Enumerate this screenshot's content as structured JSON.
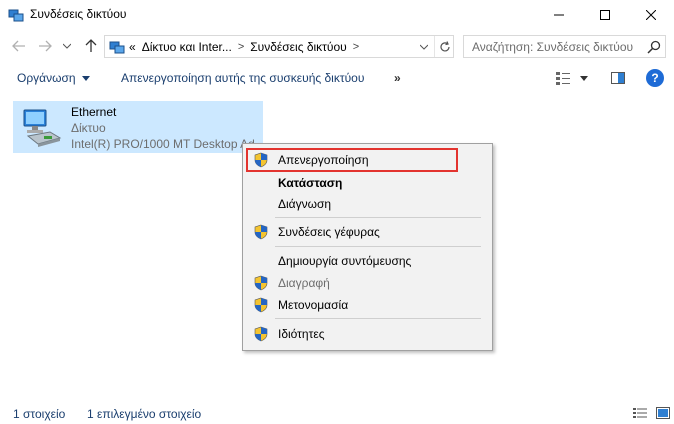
{
  "window": {
    "title": "Συνδέσεις δικτύου",
    "controls": {
      "minimize": "minimize",
      "maximize": "maximize",
      "close": "close"
    }
  },
  "navigation": {
    "breadcrumb": {
      "overflow": "«",
      "items": [
        "Δίκτυο και Inter...",
        "Συνδέσεις δικτύου"
      ]
    },
    "search_placeholder": "Αναζήτηση: Συνδέσεις δικτύου"
  },
  "commandbar": {
    "organize": "Οργάνωση",
    "disable_device": "Απενεργοποίηση αυτής της συσκευής δικτύου",
    "more": "»",
    "help": "?"
  },
  "item": {
    "name": "Ethernet",
    "type": "Δίκτυο",
    "device": "Intel(R) PRO/1000 MT Desktop Ad..."
  },
  "context_menu": {
    "items": [
      {
        "label": "Απενεργοποίηση",
        "icon": "shield-icon",
        "highlighted": true
      },
      {
        "label": "Κατάσταση",
        "bold": true
      },
      {
        "label": "Διάγνωση"
      },
      {
        "label": "Συνδέσεις γέφυρας",
        "icon": "shield-icon"
      },
      {
        "label": "Δημιουργία συντόμευσης"
      },
      {
        "label": "Διαγραφή",
        "icon": "shield-icon",
        "disabled": true
      },
      {
        "label": "Μετονομασία",
        "icon": "shield-icon"
      },
      {
        "label": "Ιδιότητες",
        "icon": "shield-icon"
      }
    ],
    "highlight_color": "#e3342f"
  },
  "statusbar": {
    "count": "1 στοιχείο",
    "selected": "1 επιλεγμένο στοιχείο"
  },
  "colors": {
    "selection": "#cce8ff",
    "link": "#1a3e6e",
    "help": "#1e6bd6"
  }
}
